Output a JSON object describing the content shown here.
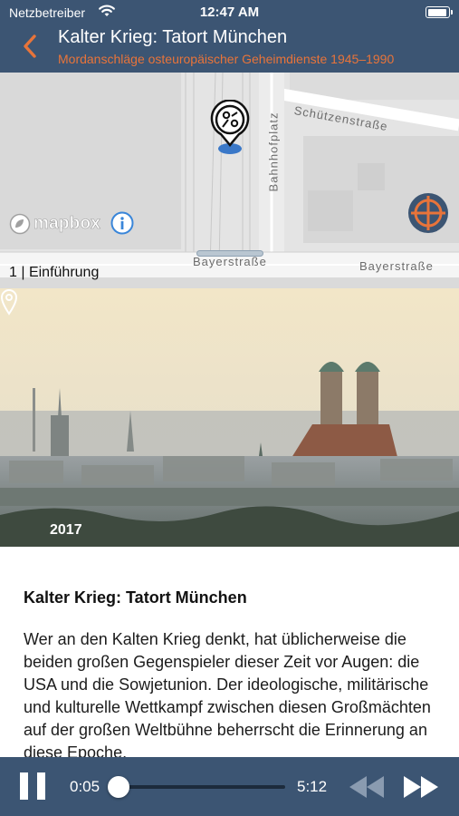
{
  "status_bar": {
    "carrier": "Netzbetreiber",
    "time": "12:47 AM",
    "battery_level": 0.8
  },
  "header": {
    "title": "Kalter Krieg: Tatort München",
    "subtitle": "Mordanschläge osteuropäischer Geheimdienste 1945–1990",
    "back_icon": "chevron-left-icon",
    "accent_color": "#e8743a",
    "bar_color": "#3c5573"
  },
  "map": {
    "streets": [
      "Schützenstraße",
      "Bahnhofplatz",
      "Bayerstraße",
      "Bayerstraße"
    ],
    "attribution": "mapbox",
    "chapter_label": "1 | Einführung",
    "pin_icon": "location-pin-icon",
    "info_icon": "info-icon",
    "locate_icon": "crosshair-icon"
  },
  "photo": {
    "year": "2017",
    "pin_icon": "location-pin-outline-icon"
  },
  "article": {
    "title": "Kalter Krieg: Tatort München",
    "body": "Wer an den Kalten Krieg denkt, hat üblicherweise die beiden großen Gegenspieler dieser Zeit vor Augen: die USA und die Sowjetunion. Der ideologische, militärische und kulturelle Wettkampf zwischen diesen Großmächten auf der großen Weltbühne beherrscht die Erinnerung an diese Epoche."
  },
  "player": {
    "current_time": "0:05",
    "total_time": "5:12",
    "progress": 0.016,
    "pause_icon": "pause-icon",
    "rewind_icon": "rewind-icon",
    "forward_icon": "fast-forward-icon"
  }
}
